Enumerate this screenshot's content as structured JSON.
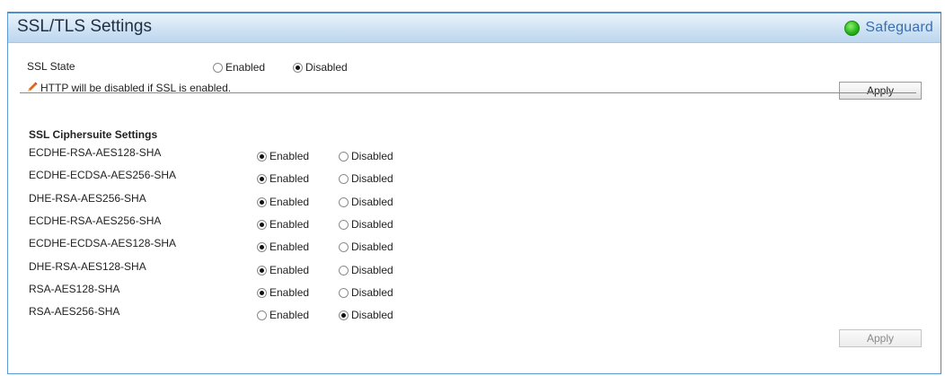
{
  "header": {
    "title": "SSL/TLS Settings",
    "safeguard_label": "Safeguard",
    "safeguard_color": "#22b11a"
  },
  "ssl_state": {
    "label": "SSL State",
    "options": [
      "Enabled",
      "Disabled"
    ],
    "selected": "Disabled",
    "note": "HTTP will be disabled if SSL is enabled.",
    "apply_label": "Apply"
  },
  "ciphersuite": {
    "title": "SSL Ciphersuite Settings",
    "enabled_label": "Enabled",
    "disabled_label": "Disabled",
    "rows": [
      {
        "name": "ECDHE-RSA-AES128-SHA",
        "selected": "Enabled"
      },
      {
        "name": "ECDHE-ECDSA-AES256-SHA",
        "selected": "Enabled"
      },
      {
        "name": "DHE-RSA-AES256-SHA",
        "selected": "Enabled"
      },
      {
        "name": "ECDHE-RSA-AES256-SHA",
        "selected": "Enabled"
      },
      {
        "name": "ECDHE-ECDSA-AES128-SHA",
        "selected": "Enabled"
      },
      {
        "name": "DHE-RSA-AES128-SHA",
        "selected": "Enabled"
      },
      {
        "name": "RSA-AES128-SHA",
        "selected": "Enabled"
      },
      {
        "name": "RSA-AES256-SHA",
        "selected": "Disabled"
      }
    ],
    "apply_label": "Apply"
  }
}
